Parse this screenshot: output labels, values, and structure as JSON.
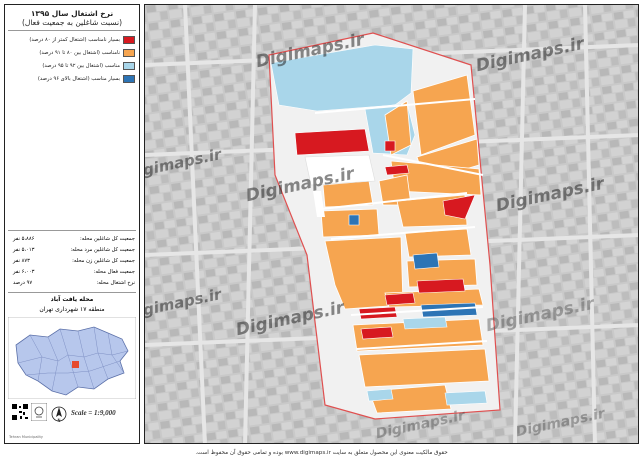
{
  "panel": {
    "title": "نرخ اشتغال سال ۱۳۹۵",
    "subtitle": "(نسبت شاغلین به جمعیت فعال)",
    "legend": [
      {
        "label": "بسیار نامناسب (اشتغال کمتر از ۸۰ درصد)",
        "color": "#d71920"
      },
      {
        "label": "نامناسب (اشتغال بین ۸۰ تا ۹۱ درصد)",
        "color": "#f6a550"
      },
      {
        "label": "مناسب (اشتغال بین ۹۲ تا ۹۵ درصد)",
        "color": "#a9d6ea"
      },
      {
        "label": "بسیار مناسب (اشتغال بالای ۹۶ درصد)",
        "color": "#2d74b5"
      }
    ],
    "stats": [
      {
        "key": "جمعیت کل شاغلین محله:",
        "value": "۵،۸۸۶ نفر"
      },
      {
        "key": "جمعیت کل شاغلین مرد محله:",
        "value": "۵،۰۱۳ نفر"
      },
      {
        "key": "جمعیت کل شاغلین زن محله:",
        "value": "۸۷۳ نفر"
      },
      {
        "key": "جمعیت فعال محله:",
        "value": "۶،۰۰۳ نفر"
      },
      {
        "key": "نرخ اشتغال محله:",
        "value": "۹۷ درصد"
      }
    ],
    "neighborhood": "محله یافت آباد",
    "district": "منطقه ۱۷ شهرداری تهران",
    "scale": "Scale = 1:9,000",
    "north": "N",
    "inset_caption": "Tehran Municipality"
  },
  "watermark": "Digimaps.ir",
  "footer": "حقوق مالکیت معنوی این محصول متعلق به سایت www.digimaps.ir بوده و تمامی حقوق آن محفوظ است."
}
